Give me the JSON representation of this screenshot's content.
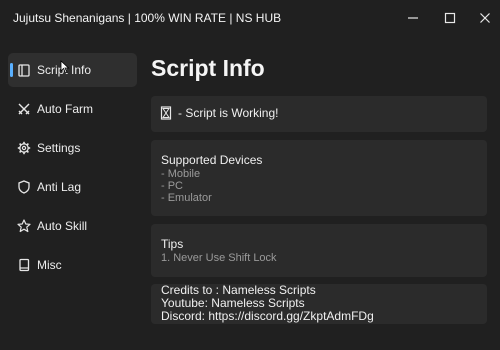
{
  "window": {
    "title": "Jujutsu Shenanigans | 100% WIN RATE | NS HUB"
  },
  "sidebar": {
    "items": [
      {
        "label": "Script Info",
        "icon": "clipboard-icon",
        "active": true
      },
      {
        "label": "Auto Farm",
        "icon": "swords-icon",
        "active": false
      },
      {
        "label": "Settings",
        "icon": "gear-icon",
        "active": false
      },
      {
        "label": "Anti Lag",
        "icon": "shield-icon",
        "active": false
      },
      {
        "label": "Auto Skill",
        "icon": "star-icon",
        "active": false
      },
      {
        "label": "Misc",
        "icon": "book-icon",
        "active": false
      }
    ]
  },
  "main": {
    "title": "Script Info",
    "status": {
      "text": "- Script is Working!",
      "icon": "hourglass-icon"
    },
    "devices": {
      "title": "Supported Devices",
      "lines": [
        "- Mobile",
        "- PC",
        "- Emulator"
      ]
    },
    "tips": {
      "title": "Tips",
      "lines": [
        "1. Never Use Shift Lock"
      ]
    },
    "credits": {
      "lines": [
        "Credits to : Nameless Scripts",
        "Youtube: Nameless Scripts",
        "Discord: https://discord.gg/ZkptAdmFDg"
      ]
    }
  },
  "colors": {
    "background": "#202020",
    "card": "#2b2b2b",
    "active_item": "#2f2f2f",
    "accent": "#5ab0ff",
    "muted_text": "#9a9a9a"
  }
}
